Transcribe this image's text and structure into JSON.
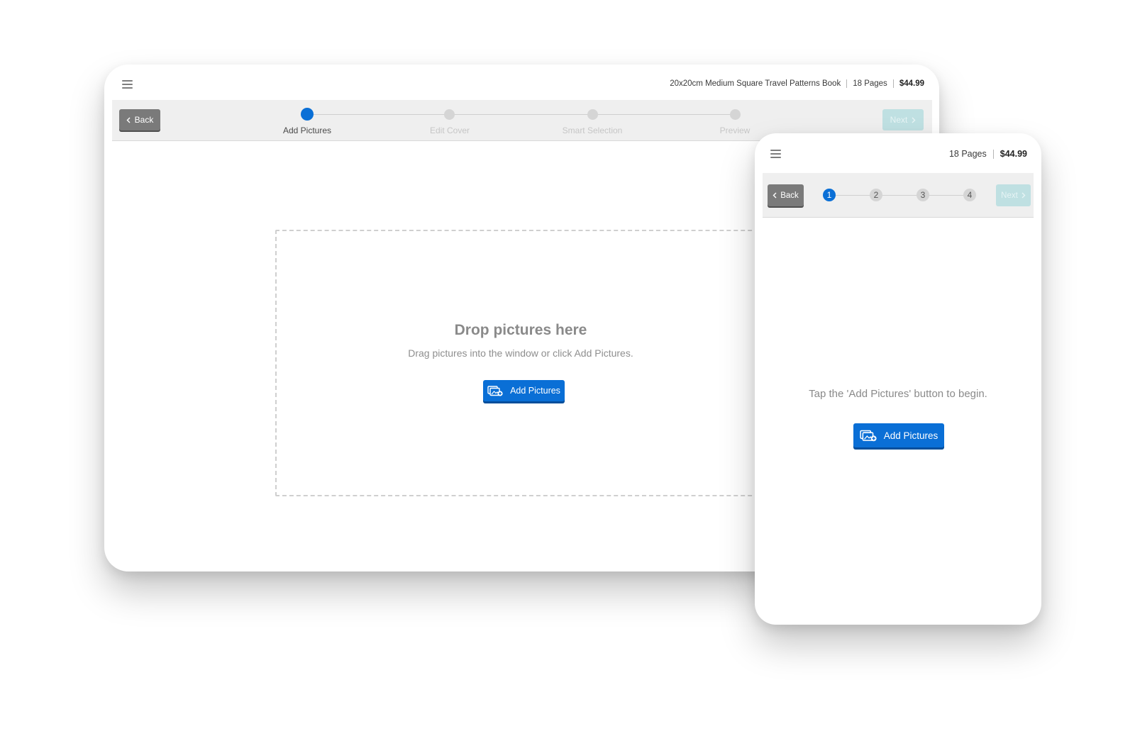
{
  "desktop": {
    "menu_icon": "hamburger-menu-icon",
    "product_title": "20x20cm Medium Square Travel Patterns Book",
    "pages": "18 Pages",
    "price": "$44.99",
    "back_label": "Back",
    "next_label": "Next",
    "steps": [
      {
        "label": "Add Pictures",
        "active": true
      },
      {
        "label": "Edit Cover",
        "active": false
      },
      {
        "label": "Smart Selection",
        "active": false
      },
      {
        "label": "Preview",
        "active": false
      }
    ],
    "drop_title": "Drop pictures here",
    "drop_subtitle": "Drag pictures into the window or click Add Pictures.",
    "add_pictures_label": "Add Pictures",
    "add_pictures_icon": "add-photos-icon"
  },
  "mobile": {
    "menu_icon": "hamburger-menu-icon",
    "pages": "18 Pages",
    "price": "$44.99",
    "back_label": "Back",
    "next_label": "Next",
    "steps": [
      "1",
      "2",
      "3",
      "4"
    ],
    "active_step": 1,
    "tap_text": "Tap the 'Add Pictures' button to begin.",
    "add_pictures_label": "Add Pictures",
    "add_pictures_icon": "add-photos-icon"
  },
  "colors": {
    "accent": "#0a6fd6",
    "back_button": "#7a7a7a",
    "next_button_disabled": "#bfe0e2",
    "step_inactive": "#d5d5d5"
  }
}
